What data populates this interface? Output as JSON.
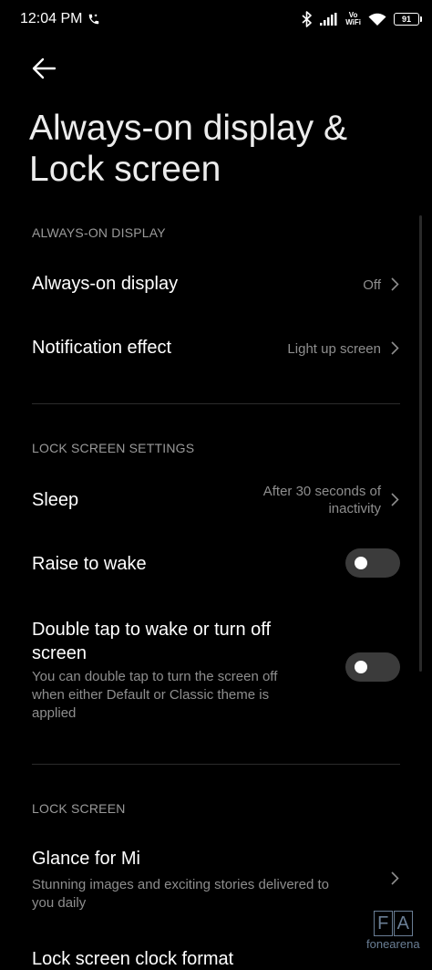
{
  "status_bar": {
    "time": "12:04 PM",
    "vowifi_top": "Vo",
    "vowifi_bottom": "WiFi",
    "battery": "91"
  },
  "header": {
    "title_line1": "Always-on display &",
    "title_line2": "Lock screen"
  },
  "sections": {
    "aod": {
      "header": "ALWAYS-ON DISPLAY",
      "always_on": {
        "title": "Always-on display",
        "value": "Off"
      },
      "notification_effect": {
        "title": "Notification effect",
        "value": "Light up screen"
      }
    },
    "lock_settings": {
      "header": "LOCK SCREEN SETTINGS",
      "sleep": {
        "title": "Sleep",
        "value_line1": "After 30 seconds of",
        "value_line2": "inactivity"
      },
      "raise_to_wake": {
        "title": "Raise to wake",
        "enabled": false
      },
      "double_tap": {
        "title_line1": "Double tap to wake or turn off",
        "title_line2": "screen",
        "desc_line1": "You can double tap to turn the screen off",
        "desc_line2": "when either Default or Classic theme is",
        "desc_line3": "applied",
        "enabled": false
      }
    },
    "lock_screen": {
      "header": "LOCK SCREEN",
      "glance": {
        "title": "Glance for Mi",
        "desc_line1": "Stunning images and exciting stories delivered to",
        "desc_line2": "you daily"
      },
      "clock_format": {
        "title": "Lock screen clock format"
      }
    }
  },
  "watermark": {
    "letter1": "F",
    "letter2": "A",
    "text": "fonearena"
  },
  "colors": {
    "background": "#000000",
    "text": "#ffffff",
    "secondary": "#8e8e8e",
    "toggle_off": "#3b3b3b"
  }
}
